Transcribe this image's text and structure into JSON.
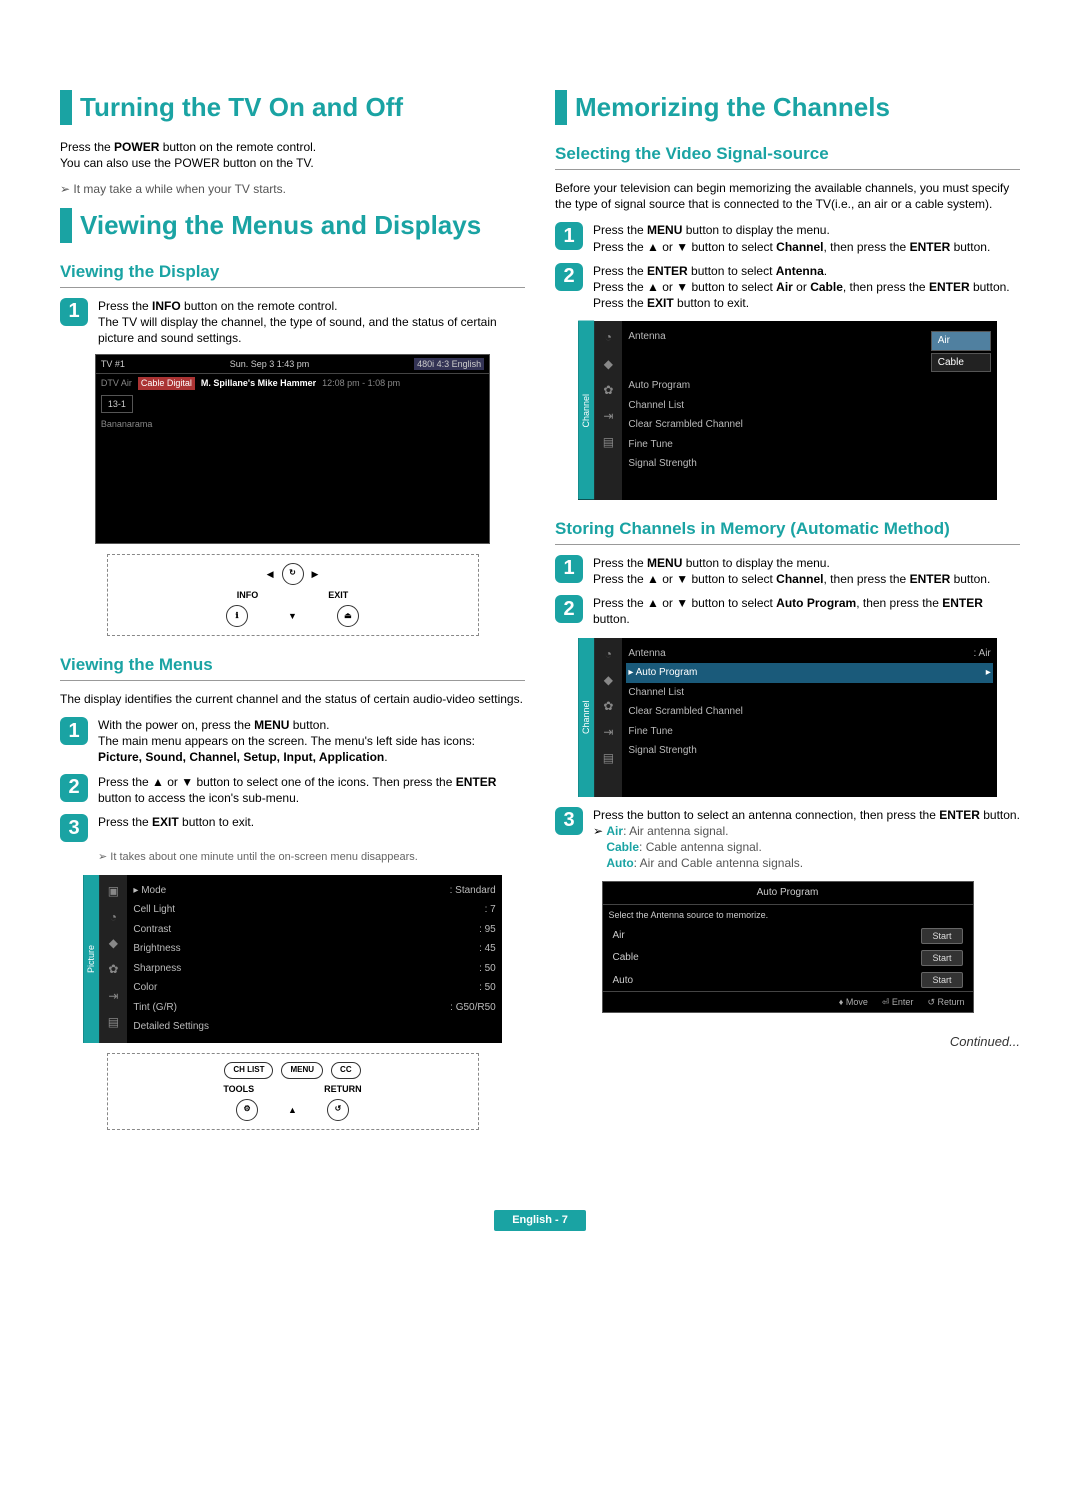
{
  "left": {
    "h1a": "Turning the TV On and Off",
    "p1a": "Press the ",
    "p1b": "POWER",
    "p1c": " button on the remote control.",
    "p1d": "You can also use the POWER button on the TV.",
    "note1": "It may take a while when your TV starts.",
    "h1b": "Viewing the Menus and Displays",
    "sub_display": "Viewing the Display",
    "disp_step": {
      "a": "Press the ",
      "b": "INFO",
      "c": " button on the remote control.",
      "d": "The TV will display the channel, the type of sound, and the status of certain picture and sound settings."
    },
    "tv1": {
      "tvnum": "TV #1",
      "date": "Sun. Sep 3  1:43 pm",
      "lang": "480i 4:3 English",
      "type": "Cable Digital",
      "show": "M. Spillane's Mike Hammer",
      "time": "12:08 pm - 1:08 pm",
      "ch": "13-1",
      "genre": "Bananarama"
    },
    "remote1": {
      "info": "INFO",
      "exit": "EXIT"
    },
    "sub_menus": "Viewing the Menus",
    "menus_intro": "The display identifies the current channel and the status of certain audio-video settings.",
    "m1": {
      "a": "With the power on, press the ",
      "b": "MENU",
      "c": " button.",
      "d": "The main menu appears on the screen. The menu's left side has icons:",
      "e": "Picture, Sound, Channel, Setup, Input, Application"
    },
    "m2": {
      "a": "Press the ▲ or ▼ button to select one of the icons. Then press the ",
      "b": "ENTER",
      "c": " button to access the icon's sub-menu."
    },
    "m3": {
      "a": "Press the ",
      "b": "EXIT",
      "c": " button to exit."
    },
    "note2": "It takes about one minute until the on-screen menu disappears.",
    "picture_menu": {
      "tab": "Picture",
      "items": [
        {
          "k": "Mode",
          "v": ": Standard"
        },
        {
          "k": "Cell Light",
          "v": ": 7"
        },
        {
          "k": "Contrast",
          "v": ": 95"
        },
        {
          "k": "Brightness",
          "v": ": 45"
        },
        {
          "k": "Sharpness",
          "v": ": 50"
        },
        {
          "k": "Color",
          "v": ": 50"
        },
        {
          "k": "Tint (G/R)",
          "v": ": G50/R50"
        },
        {
          "k": "Detailed Settings",
          "v": ""
        }
      ]
    },
    "remote2": {
      "chlist": "CH LIST",
      "menu": "MENU",
      "cc": "CC",
      "tools": "TOOLS",
      "return": "RETURN"
    }
  },
  "right": {
    "h1": "Memorizing the Channels",
    "sub_source": "Selecting the Video Signal-source",
    "source_intro": "Before your television can begin memorizing the available channels, you must specify the type of signal source that is connected to the TV(i.e., an air or a cable system).",
    "s1": {
      "a": "Press the ",
      "b": "MENU",
      "c": " button to display the menu.",
      "d": "Press the ▲ or ▼ button to select ",
      "e": "Channel",
      "f": ", then press the ",
      "g": "ENTER",
      "h": " button."
    },
    "s2": {
      "a": "Press the ",
      "b": "ENTER",
      "c": " button to select ",
      "d": "Antenna",
      "e": ".",
      "f": "Press the ▲ or ▼ button to select ",
      "g": "Air",
      "h": " or ",
      "i": "Cable",
      "j": ", then press the ",
      "k": "ENTER",
      "l": " button. Press the ",
      "m": "EXIT",
      "n": " button to exit."
    },
    "ch_menu": {
      "tab": "Channel",
      "items": [
        "Antenna",
        "Auto Program",
        "Channel List",
        "Clear Scrambled Channel",
        "Fine Tune",
        "Signal Strength"
      ],
      "opt1": "Air",
      "opt2": "Cable"
    },
    "sub_store": "Storing Channels in Memory (Automatic Method)",
    "t1": {
      "a": "Press the ",
      "b": "MENU",
      "c": " button to display the menu.",
      "d": "Press the ▲ or ▼ button to select ",
      "e": "Channel",
      "f": ", then press the ",
      "g": "ENTER",
      "h": " button."
    },
    "t2": {
      "a": "Press the ▲ or ▼ button to select ",
      "b": "Auto Program",
      "c": ", then press the ",
      "d": "ENTER",
      "e": " button."
    },
    "ch_menu2": {
      "tab": "Channel",
      "antenna_val": ": Air",
      "items": [
        "Antenna",
        "Auto Program",
        "Channel List",
        "Clear Scrambled Channel",
        "Fine Tune",
        "Signal Strength"
      ]
    },
    "t3": {
      "a": "Press the   button to select an antenna connection, then press the ",
      "b": "ENTER",
      "c": " button."
    },
    "ant_notes": {
      "air_l": "Air",
      "air_v": ": Air antenna signal.",
      "cable_l": "Cable",
      "cable_v": ": Cable antenna signal.",
      "auto_l": "Auto",
      "auto_v": ": Air and Cable antenna signals."
    },
    "dialog": {
      "title": "Auto Program",
      "sub": "Select the Antenna source to memorize.",
      "rows": [
        "Air",
        "Cable",
        "Auto"
      ],
      "start": "Start",
      "move": "Move",
      "enter": "Enter",
      "return": "Return"
    },
    "continued": "Continued..."
  },
  "footer": "English - 7"
}
